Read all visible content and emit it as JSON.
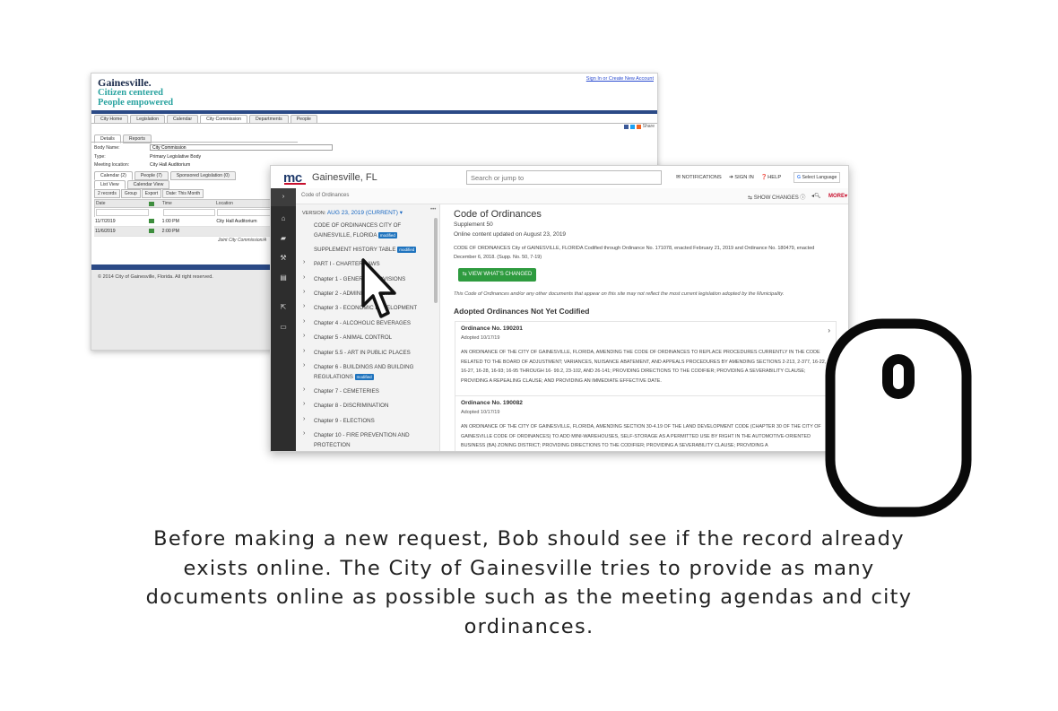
{
  "legistar": {
    "logo_line1": "Gainesville.",
    "logo_line2": "Citizen centered",
    "logo_line3": "People empowered",
    "signin_link": "Sign In or Create New Account",
    "main_tabs": [
      "City Home",
      "Legislation",
      "Calendar",
      "City Commission",
      "Departments",
      "People"
    ],
    "share_label": "Share",
    "sub_tabs": [
      "Details",
      "Reports"
    ],
    "fields": [
      {
        "label": "Body Name:",
        "value": "City Commission"
      },
      {
        "label": "Type:",
        "value": "Primary Legislative Body"
      },
      {
        "label": "Meeting location:",
        "value": "City Hall Auditorium"
      }
    ],
    "section_tabs": [
      "Calendar (2)",
      "People (7)",
      "Sponsored Legislation (0)"
    ],
    "view_tabs": [
      "List View",
      "Calendar View"
    ],
    "toolbar": [
      "2 records",
      "Group",
      "Export",
      "Date: This Month"
    ],
    "grid_headers": [
      "Date",
      "",
      "Time",
      "Location"
    ],
    "grid_rows": [
      {
        "date": "11/7/2019",
        "time": "1:00 PM",
        "location": "City Hall Auditorium"
      },
      {
        "date": "11/6/2019",
        "time": "2:00 PM",
        "location": ""
      }
    ],
    "joint_note": "Joint City Commission/A",
    "copyright": "© 2014 City of Gainesville, Florida. All right reserved."
  },
  "municode": {
    "logo": "mc",
    "city": "Gainesville, FL",
    "search_placeholder": "Search or jump to",
    "top_links": [
      "NOTIFICATIONS",
      "SIGN IN",
      "HELP"
    ],
    "language": "Select Language",
    "breadcrumb": "Code of Ordinances",
    "show_changes": "SHOW CHANGES",
    "more": "MORE",
    "version_label": "VERSION:",
    "version_value": "AUG 23, 2019 (CURRENT)",
    "modified_badge": "modified",
    "toc_items": [
      "CODE OF ORDINANCES CITY OF GAINESVILLE, FLORIDA",
      "SUPPLEMENT HISTORY TABLE",
      "PART I - CHARTER LAWS",
      "Chapter 1 - GENERAL PROVISIONS",
      "Chapter 2 - ADMINISTRATION",
      "Chapter 3 - ECONOMIC DEVELOPMENT",
      "Chapter 4 - ALCOHOLIC BEVERAGES",
      "Chapter 5 - ANIMAL CONTROL",
      "Chapter 5.5 - ART IN PUBLIC PLACES",
      "Chapter 6 - BUILDINGS AND BUILDING REGULATIONS",
      "Chapter 7 - CEMETERIES",
      "Chapter 8 - DISCRIMINATION",
      "Chapter 9 - ELECTIONS",
      "Chapter 10 - FIRE PREVENTION AND PROTECTION"
    ],
    "title": "Code of Ordinances",
    "supplement": "Supplement 50",
    "online_updated": "Online content updated on August 23, 2019",
    "description": "CODE OF ORDINANCES City of GAINESVILLE, FLORIDA Codified through Ordinance No. 171078, enacted February 21, 2019 and Ordinance No. 180479, enacted December 6, 2018. (Supp. No. 50, 7-19)",
    "view_changed_button": "VIEW WHAT'S CHANGED",
    "disclaimer": "This Code of Ordinances and/or any other documents that appear on this site may not reflect the most current legislation adopted by the Municipality.",
    "adopted_heading": "Adopted Ordinances Not Yet Codified",
    "ordinances": [
      {
        "number": "Ordinance No. 190201",
        "adopted": "Adopted 10/17/19",
        "text": "AN ORDINANCE OF THE CITY OF GAINESVILLE, FLORIDA, AMENDING THE CODE OF ORDINANCES TO REPLACE PROCEDURES CURRENTLY IN THE CODE RELATED TO THE BOARD OF ADJUSTMENT; VARIANCES, NUISANCE ABATEMENT, AND APPEALS PROCEDURES BY AMENDING SECTIONS 2-213, 2-377, 16-22, 16-27, 16-28, 16-93; 16-95 THROUGH 16- 99.2, 23-102, AND 26-141; PROVIDING DIRECTIONS TO THE CODIFIER; PROVIDING A SEVERABILITY CLAUSE; PROVIDING A REPEALING CLAUSE; AND PROVIDING AN IMMEDIATE EFFECTIVE DATE."
      },
      {
        "number": "Ordinance No. 190082",
        "adopted": "Adopted 10/17/19",
        "text": "AN ORDINANCE OF THE CITY OF GAINESVILLE, FLORIDA, AMENDING SECTION 30-4.19 OF THE LAND DEVELOPMENT CODE (CHAPTER 30 OF THE CITY OF GAINESVILLE CODE OF ORDINANCES) TO ADD MINI-WAREHOUSES, SELF-STORAGE AS A PERMITTED USE BY RIGHT IN THE AUTOMOTIVE-ORIENTED BUSINESS (BA) ZONING DISTRICT; PROVIDING DIRECTIONS TO THE CODIFIER; PROVIDING A SEVERABILITY CLAUSE; PROVIDING A"
      }
    ]
  },
  "caption": "Before making a new request, Bob should see if the record already exists online. The City of Gainesville tries to provide as many documents online as possible such as the meeting agendas and city ordinances.",
  "colors": {
    "legistar_blue": "#2b4a86",
    "legistar_teal": "#2aa3a0",
    "municode_navy": "#1f3a6b",
    "municode_red": "#c8102e",
    "button_green": "#2e9b3f",
    "badge_blue": "#1e73be"
  },
  "icons": [
    "cursor-arrow-icon",
    "computer-mouse-icon",
    "home-icon",
    "book-icon",
    "gavel-icon",
    "document-icon",
    "external-link-icon",
    "card-icon",
    "bell-icon",
    "search-icon"
  ]
}
